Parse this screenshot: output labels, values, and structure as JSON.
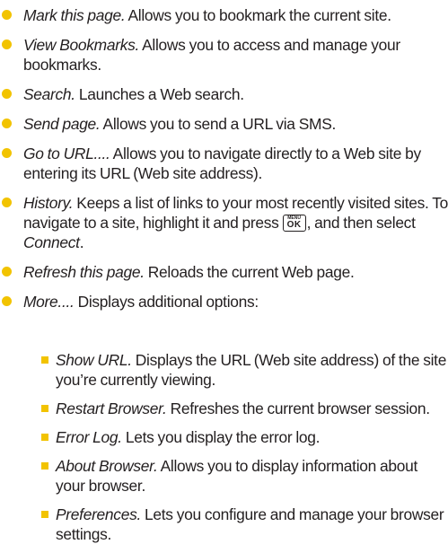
{
  "bullet_color": "#f2c300",
  "items": [
    {
      "term": "Mark this page.",
      "desc": " Allows you to bookmark the current site."
    },
    {
      "term": "View Bookmarks.",
      "desc": " Allows you to access and manage your bookmarks."
    },
    {
      "term": "Search.",
      "desc": " Launches a Web search."
    },
    {
      "term": "Send page.",
      "desc": " Allows you to send a URL via SMS."
    },
    {
      "term": "Go to URL....",
      "desc": " Allows you to navigate directly to a Web site by entering its URL (Web site address)."
    },
    {
      "term": "History.",
      "desc_before_key": " Keeps a list of links to your most recently visited sites. To navigate to a site, highlight it and press ",
      "key_top": "MENU",
      "key_main": "OK",
      "desc_after_key": ", and then select ",
      "connect": "Connect",
      "period": "."
    },
    {
      "term": "Refresh this page.",
      "desc": " Reloads the current Web page."
    },
    {
      "term": "More....",
      "desc": " Displays additional options:"
    }
  ],
  "sub_items": [
    {
      "term": "Show URL.",
      "desc": " Displays the URL (Web site address) of the site you’re currently viewing."
    },
    {
      "term": "Restart Browser.",
      "desc": " Refreshes the current browser session."
    },
    {
      "term": "Error Log.",
      "desc": " Lets you display the error log."
    },
    {
      "term": "About Browser.",
      "desc": " Allows you to display information about your browser."
    },
    {
      "term": "Preferences.",
      "desc": " Lets you configure and manage your browser settings."
    }
  ]
}
